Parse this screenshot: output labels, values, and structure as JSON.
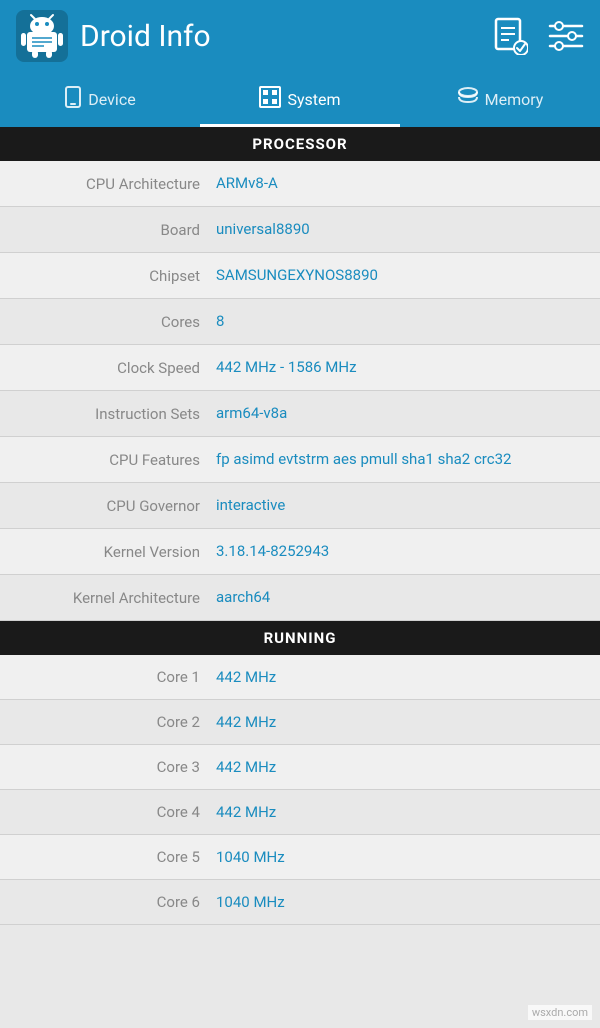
{
  "header": {
    "title": "Droid Info",
    "report_icon": "report-icon",
    "settings_icon": "settings-icon"
  },
  "tabs": [
    {
      "id": "device",
      "label": "Device",
      "icon": "📱",
      "active": false
    },
    {
      "id": "system",
      "label": "System",
      "icon": "🔲",
      "active": true
    },
    {
      "id": "memory",
      "label": "Memory",
      "icon": "💾",
      "active": false
    }
  ],
  "processor_section": {
    "heading": "PROCESSOR",
    "rows": [
      {
        "label": "CPU Architecture",
        "value": "ARMv8-A"
      },
      {
        "label": "Board",
        "value": "universal8890"
      },
      {
        "label": "Chipset",
        "value": "SAMSUNGEXYNOS8890"
      },
      {
        "label": "Cores",
        "value": "8"
      },
      {
        "label": "Clock Speed",
        "value": "442 MHz - 1586 MHz"
      },
      {
        "label": "Instruction Sets",
        "value": "arm64-v8a"
      },
      {
        "label": "CPU Features",
        "value": "fp asimd evtstrm aes pmull sha1 sha2 crc32"
      },
      {
        "label": "CPU Governor",
        "value": "interactive"
      },
      {
        "label": "Kernel Version",
        "value": "3.18.14-8252943"
      },
      {
        "label": "Kernel Architecture",
        "value": "aarch64"
      }
    ]
  },
  "running_section": {
    "heading": "RUNNING",
    "rows": [
      {
        "label": "Core 1",
        "value": "442 MHz"
      },
      {
        "label": "Core 2",
        "value": "442 MHz"
      },
      {
        "label": "Core 3",
        "value": "442 MHz"
      },
      {
        "label": "Core 4",
        "value": "442 MHz"
      },
      {
        "label": "Core 5",
        "value": "1040 MHz"
      },
      {
        "label": "Core 6",
        "value": "1040 MHz"
      }
    ]
  },
  "watermark": "wsxdn.com",
  "accent_color": "#1a8cbf"
}
